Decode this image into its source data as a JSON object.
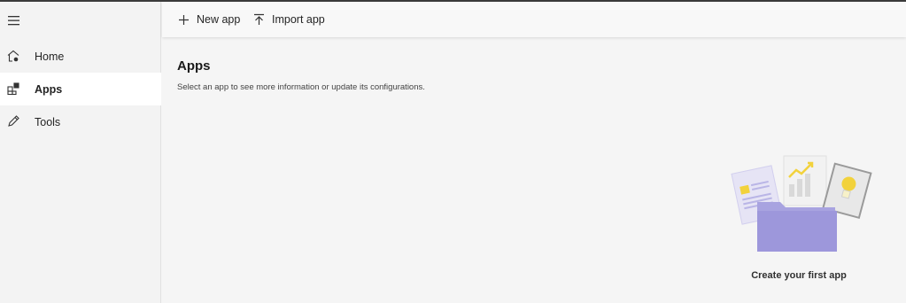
{
  "sidebar": {
    "menu_icon": "hamburger-icon",
    "items": [
      {
        "label": "Home",
        "icon": "home-icon",
        "active": false
      },
      {
        "label": "Apps",
        "icon": "apps-icon",
        "active": true
      },
      {
        "label": "Tools",
        "icon": "pencil-icon",
        "active": false
      }
    ]
  },
  "command_bar": {
    "new_app_label": "New app",
    "new_app_icon": "plus-icon",
    "import_app_label": "Import app",
    "import_app_icon": "upload-icon"
  },
  "main": {
    "title": "Apps",
    "subtitle": "Select an app to see more information or update its configurations.",
    "empty_state": {
      "illustration": "folder-documents-illustration",
      "text": "Create your first app"
    }
  },
  "colors": {
    "background": "#f5f5f5",
    "sidebar_active": "#ffffff",
    "accent_purple": "#a8a3e0",
    "accent_yellow": "#f2d23c"
  }
}
